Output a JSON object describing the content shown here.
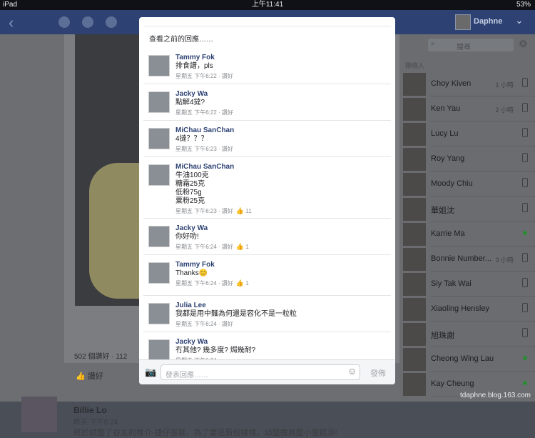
{
  "status": {
    "device": "iPad",
    "time": "上午11:41",
    "battery": "53%"
  },
  "nav": {
    "user": "Daphne"
  },
  "feed": {
    "likes": "502 個讚好 · 112 ",
    "like_label": "讚好",
    "next_post": {
      "name": "Billie Lo",
      "time": "昨天 下午8:24",
      "text": "終於試整了谷友的推介-捷仔蛋糕，為了要追費個樣樣，幼整撲員整小蛋糕添!"
    }
  },
  "sidebar": {
    "search": "搜尋",
    "section": "聯絡人",
    "contacts": [
      {
        "name": "Choy Kiven",
        "meta": "1 小時",
        "status": "phone"
      },
      {
        "name": "Ken Yau",
        "meta": "2 小時",
        "status": "phone"
      },
      {
        "name": "Lucy Lu",
        "meta": "",
        "status": "phone"
      },
      {
        "name": "Roy Yang",
        "meta": "",
        "status": "phone"
      },
      {
        "name": "Moody Chiu",
        "meta": "",
        "status": "phone"
      },
      {
        "name": "華姐沈",
        "meta": "",
        "status": "phone"
      },
      {
        "name": "Karrie Ma",
        "meta": "",
        "status": "online"
      },
      {
        "name": "Bonnie Number...",
        "meta": "3 小時",
        "status": "phone"
      },
      {
        "name": "Siy Tak Wai",
        "meta": "",
        "status": "phone"
      },
      {
        "name": "Xiaoling Hensley",
        "meta": "",
        "status": "phone"
      },
      {
        "name": "旭珠謝",
        "meta": "",
        "status": "phone"
      },
      {
        "name": "Cheong Wing Lau",
        "meta": "",
        "status": "online"
      },
      {
        "name": "Kay Cheung",
        "meta": "",
        "status": "online"
      }
    ]
  },
  "watermark": "tdaphne.blog.163.com",
  "modal": {
    "more": "查看之前的回應……",
    "comments": [
      {
        "name": "Tammy Fok",
        "text": "排食譜，pls",
        "time": "星期五 下午6:22",
        "action": "讚好",
        "likes": ""
      },
      {
        "name": "Jacky Wa",
        "text": "點解4撻?",
        "time": "星期五 下午6:22",
        "action": "讚好",
        "likes": ""
      },
      {
        "name": "MiChau SanChan",
        "text": "4撻？？？",
        "time": "星期五 下午6:23",
        "action": "讚好",
        "likes": ""
      },
      {
        "name": "MiChau SanChan",
        "text": "牛油100克\n糖霜25克\n低粉75g\n粟粉25克",
        "time": "星期五 下午6:23",
        "action": "讚好",
        "likes": "11"
      },
      {
        "name": "Jacky Wa",
        "text": "你好叻!",
        "time": "星期五 下午6:24",
        "action": "讚好",
        "likes": "1"
      },
      {
        "name": "Tammy Fok",
        "text": "Thanks😊",
        "time": "星期五 下午6:24",
        "action": "讚好",
        "likes": "1"
      },
      {
        "name": "Julia Lee",
        "text": "我都是用中麵為何還是容化不是一粒粒",
        "time": "星期五 下午6:24",
        "action": "讚好",
        "likes": ""
      },
      {
        "name": "Jacky Wa",
        "text": "冇其他? 幾多度? 焗幾耐?",
        "time": "星期五 下午6:24",
        "action": "",
        "likes": ""
      }
    ],
    "composer": {
      "placeholder": "發表回應……",
      "send": "發佈"
    }
  }
}
